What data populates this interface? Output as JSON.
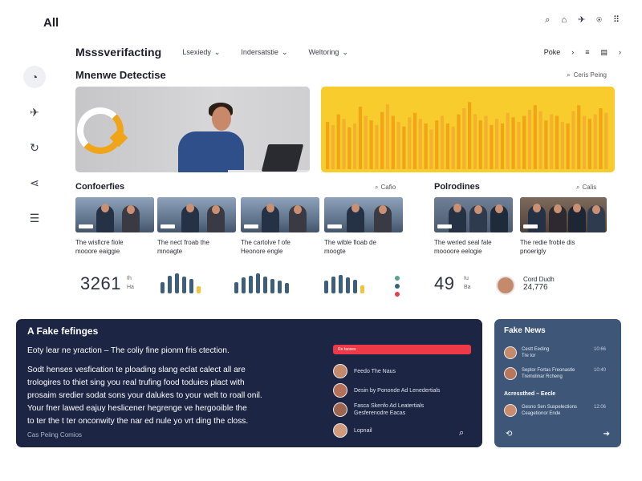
{
  "app": {
    "logo": "All"
  },
  "top_icons": [
    "search-icon",
    "bell-icon",
    "send-icon",
    "lock-icon",
    "grid-icon"
  ],
  "sidebar": {
    "items": [
      {
        "icon": "gauge-icon",
        "glyph": "◔"
      },
      {
        "icon": "rocket-icon",
        "glyph": "✈"
      },
      {
        "icon": "refresh-icon",
        "glyph": "↻"
      },
      {
        "icon": "share-icon",
        "glyph": "⋖"
      },
      {
        "icon": "menu-icon",
        "glyph": "☰"
      }
    ]
  },
  "header": {
    "title": "Msssverifacting",
    "filters": [
      "Lsexiedy",
      "Indersatstie",
      "Weltoring"
    ],
    "profile_label": "Poke",
    "chevron": "›",
    "list_glyph": "≡",
    "cal_glyph": "▤",
    "next_glyph": "›"
  },
  "section": {
    "title": "Mnenwe Detectise",
    "sort_label": "Ceris Peing"
  },
  "hero_chart": {
    "color": "#f0a417",
    "background": "#f8cc2c"
  },
  "chart_data": {
    "type": "bar",
    "values": [
      62,
      58,
      72,
      66,
      55,
      60,
      82,
      70,
      64,
      58,
      75,
      85,
      70,
      62,
      56,
      68,
      74,
      66,
      60,
      52,
      64,
      70,
      60,
      56,
      72,
      80,
      88,
      72,
      64,
      70,
      58,
      66,
      60,
      74,
      68,
      62,
      70,
      78,
      84,
      76,
      64,
      72,
      70,
      62,
      60,
      76,
      84,
      70,
      66,
      72,
      80,
      74
    ],
    "ylim": [
      0,
      100
    ],
    "colors": [
      "#f0a417",
      "#f3b22d"
    ]
  },
  "conferences": {
    "title": "Confoerfies",
    "link": "Cafio",
    "cards": [
      {
        "text_line1": "The wisficre fiole",
        "text_line2": "mooore eaiggie"
      },
      {
        "text_line1": "The nect froab the",
        "text_line2": "mnoagte"
      },
      {
        "text_line1": "The cartolve f ofe",
        "text_line2": "Heonore engle"
      },
      {
        "text_line1": "The wible fioab de",
        "text_line2": "moogte"
      }
    ],
    "stat_number": "3261",
    "stat_small_1": "Ih",
    "stat_small_2": "Ha",
    "bars_a": [
      0.55,
      0.85,
      0.95,
      0.8,
      0.7,
      0.35
    ],
    "bars_b": [
      0.55,
      0.75,
      0.85,
      0.95,
      0.8,
      0.7,
      0.6,
      0.5
    ],
    "bars_c": [
      0.6,
      0.8,
      0.9,
      0.75,
      0.65,
      0.4
    ],
    "bar_color": "#3e5f7c",
    "bar_accent": "#f3c33a",
    "dot_colors": [
      "#5aa38a",
      "#3e5f7c",
      "#e0404f"
    ]
  },
  "politics": {
    "title": "Polrodines",
    "link": "Calis",
    "cards": [
      {
        "text_line1": "The weried seal fale",
        "text_line2": "moooore eelogie"
      },
      {
        "text_line1": "The redie froble dis",
        "text_line2": "pnoerigly"
      }
    ],
    "stat_number": "49",
    "stat_small_1": "Iu",
    "stat_small_2": "Ba",
    "person_name": "Cord Dudh",
    "person_value": "24,776"
  },
  "fake_feelings": {
    "title": "A Fake fefinges",
    "intro": "Eoty lear ne yraction – The coliy fine pionm fris ctection.",
    "para1_line1": "Sodt henses vesfication te ploading slang eclat calect all are",
    "para1_line2": "trologires to thiet sing you real trufing food toduies plact with",
    "para1_line3": "prosaim sredier sodat sons your dalukes to your welt to roall onil.",
    "para2_line1": "Your fner lawed eajuy heslicener hegrenge ve hergooible the",
    "para2_line2": "to ter the t ter onconwity the nar ed nule yo vrt ding the closs.",
    "footer": "Cas Peiing Comios",
    "live_label": "Re taoses",
    "feed": [
      {
        "line1": "Feedo The Naus",
        "line2": ""
      },
      {
        "line1": "Desin by Pononde Ad Lenedertials",
        "line2": ""
      },
      {
        "line1": "Fasca Skenfo Ad Leatertials",
        "line2": "Gesferenodre Eacas"
      },
      {
        "line1": "Lopnail",
        "line2": ""
      }
    ],
    "search_glyph": "⌕"
  },
  "fake_news": {
    "title": "Fake News",
    "items": [
      {
        "line1": "Cestt Eeding",
        "line2": "Tre tor",
        "meta": "10:66"
      },
      {
        "line1": "Septor Fortas Freonastle",
        "line2": "Tremolinar Rcheng",
        "meta": "10:40"
      },
      {
        "line1": "Gesno Sen Suspelections",
        "line2": "Ceagetionor Ende",
        "meta": "12:06"
      }
    ],
    "sub_label": "Acressthed – Eecle",
    "footer_left_glyph": "⟲",
    "footer_right_glyph": "➔"
  }
}
